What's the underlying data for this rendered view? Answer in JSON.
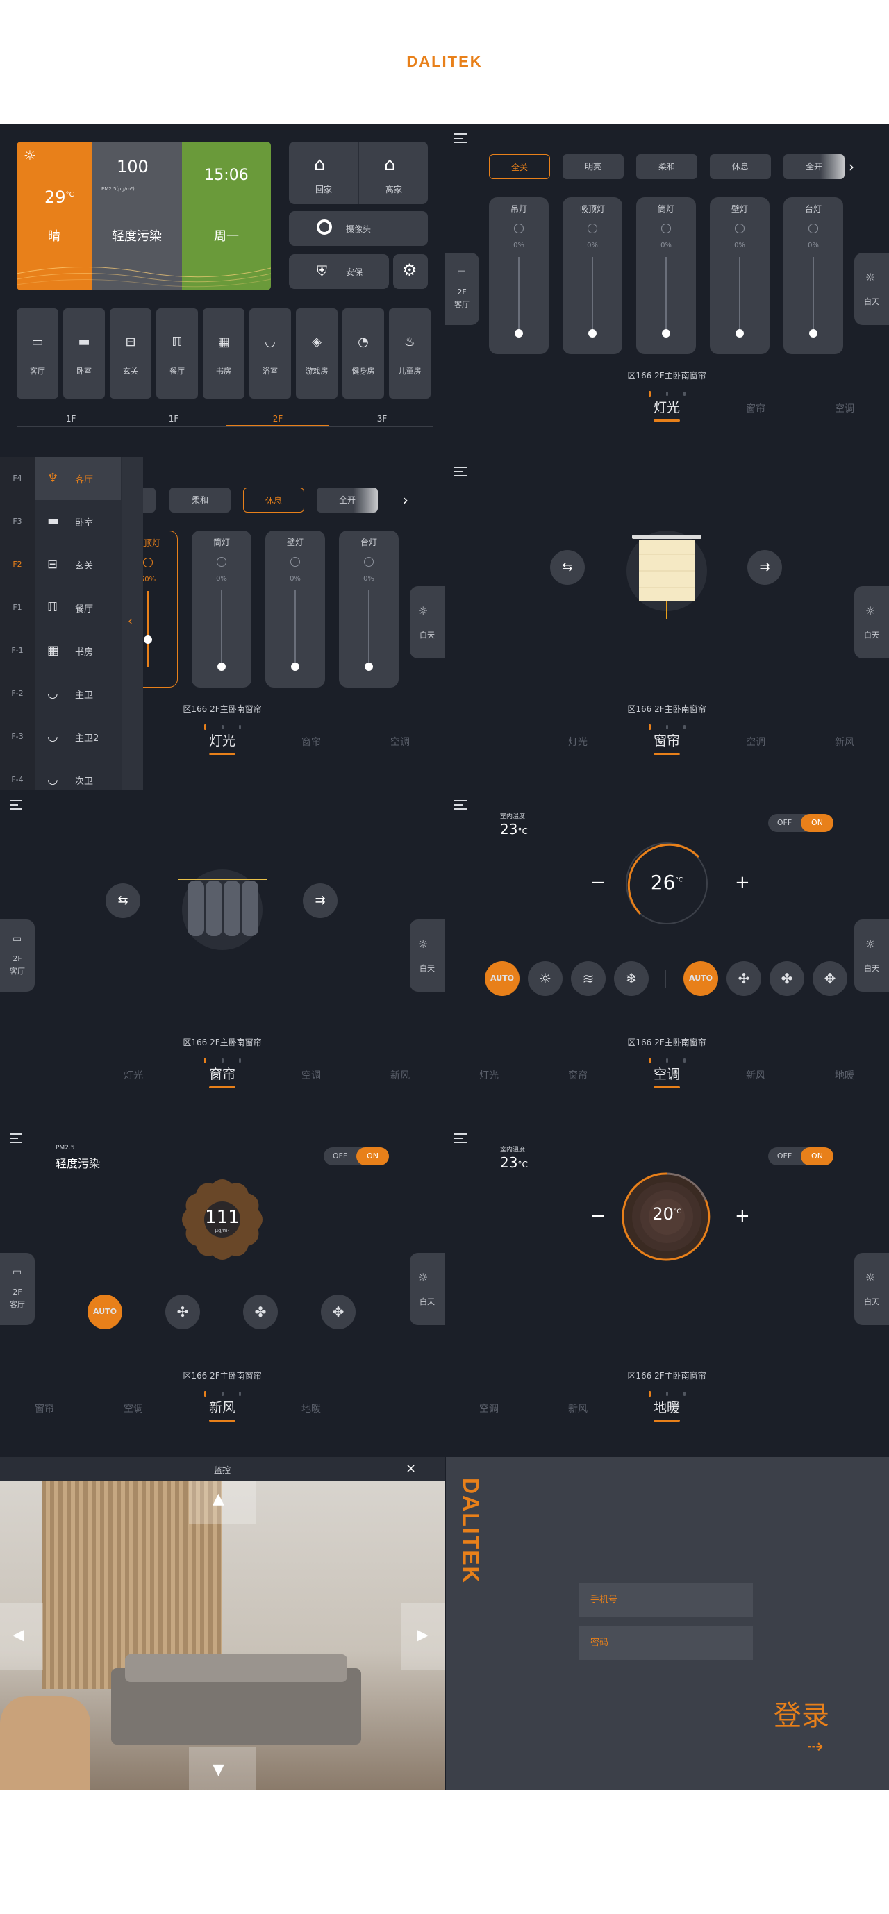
{
  "brand": {
    "logo": "DALITEK",
    "accent": "#e8801a",
    "bg": "#1b1f28"
  },
  "home": {
    "weather": {
      "temp": "29",
      "unit": "°C",
      "condition": "晴"
    },
    "air": {
      "value": "100",
      "unit": "PM2.5(μg/m³)",
      "status": "轻度污染"
    },
    "clock": {
      "time": "15:06",
      "day": "周一"
    },
    "buttons": {
      "home": "回家",
      "away": "离家",
      "camera": "摄像头",
      "security": "安保"
    },
    "rooms": [
      "客厅",
      "卧室",
      "玄关",
      "餐厅",
      "书房",
      "浴室",
      "游戏房",
      "健身房",
      "儿童房"
    ],
    "floors": [
      "-1F",
      "1F",
      "2F",
      "3F"
    ],
    "active_floor": "2F"
  },
  "side_floor": {
    "floor": "2F",
    "room": "客厅",
    "mode": "白天"
  },
  "location": "区166 2F主卧南窗帘",
  "light": {
    "modes": [
      "全关",
      "明亮",
      "柔和",
      "休息",
      "全开"
    ],
    "lamps": [
      {
        "name": "吊灯",
        "value": "0%"
      },
      {
        "name": "吸顶灯",
        "value": "0%"
      },
      {
        "name": "筒灯",
        "value": "0%"
      },
      {
        "name": "壁灯",
        "value": "0%"
      },
      {
        "name": "台灯",
        "value": "0%"
      }
    ],
    "expanded_lamp": {
      "name": "吸顶灯",
      "value": "50%"
    }
  },
  "drawer": {
    "floors": [
      "F4",
      "F3",
      "F2",
      "F1",
      "F-1",
      "F-2",
      "F-3",
      "F-4"
    ],
    "active_floor": "F2",
    "rooms": [
      "客厅",
      "卧室",
      "玄关",
      "餐厅",
      "书房",
      "主卫",
      "主卫2",
      "次卫"
    ]
  },
  "tabs": {
    "light": "灯光",
    "curtain": "窗帘",
    "ac": "空调",
    "fresh": "新风",
    "floorheat": "地暖"
  },
  "ac": {
    "indoor_label": "室内温度",
    "indoor": "23",
    "unit": "°C",
    "set": "26",
    "off": "OFF",
    "on": "ON",
    "auto": "AUTO"
  },
  "fresh": {
    "pm_label": "PM2.5",
    "status": "轻度污染",
    "value": "111",
    "unit": "μg/m³"
  },
  "floorheat": {
    "indoor_label": "室内温度",
    "indoor": "23",
    "unit": "°C",
    "set": "20"
  },
  "monitor": {
    "title": "监控",
    "close": "×"
  },
  "login": {
    "phone": "手机号",
    "password": "密码",
    "submit": "登录",
    "arrow": "⇢"
  }
}
